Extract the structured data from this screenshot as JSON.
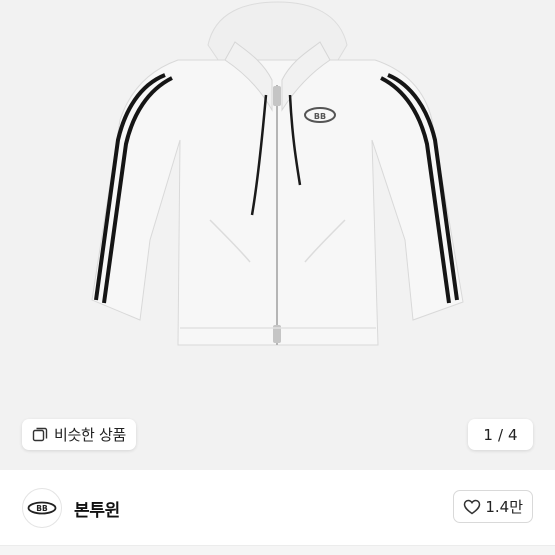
{
  "gallery": {
    "similar_button_label": "비슷한 상품",
    "page_current": "1",
    "page_separator": "/",
    "page_total": "4"
  },
  "shop": {
    "name": "본투윈"
  },
  "like": {
    "count": "1.4만"
  },
  "icons": {
    "similar": "similar-items-icon",
    "heart": "heart-outline-icon",
    "shop_logo": "brand-logo-icon"
  },
  "colors": {
    "gallery_bg": "#f2f2f2",
    "stripe": "#151515",
    "hoodie": "#f7f7f7"
  }
}
